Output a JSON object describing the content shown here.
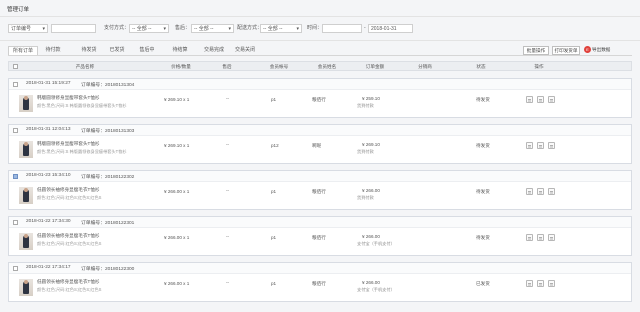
{
  "page": {
    "title": "管理订单"
  },
  "filters": {
    "order_field": "订单编号",
    "order_input": "",
    "pay_label": "支付方式：",
    "pay_select": "-- 全部 --",
    "status_label": "售后：",
    "status_select": "-- 全部 --",
    "ship_label": "配送方式：",
    "ship_select": "-- 全部 --",
    "time_label": "时间：",
    "date_from": "",
    "date_sep": "-",
    "date_to": "2018-01-31"
  },
  "tabs": [
    {
      "label": "所有订单",
      "active": true
    },
    {
      "label": "待付款"
    },
    {
      "label": "待发货"
    },
    {
      "label": "已发货"
    },
    {
      "label": "售后中"
    },
    {
      "label": "待结算"
    },
    {
      "label": "交易完成"
    },
    {
      "label": "交易关闭"
    }
  ],
  "actions": {
    "batch": "批量操作",
    "print": "打印发货单",
    "export": "导出数据",
    "export_icon": "E"
  },
  "table_headers": [
    "产品名称",
    "价格/数量",
    "售后",
    "会员帐号",
    "会员姓名",
    "订单金额",
    "分销商",
    "状态",
    "操作"
  ],
  "orders": [
    {
      "date": "2018-01-31 15:19:27",
      "order_no": "订单编号：20180131304",
      "product": "韩版圆领修身显瘦带套头T恤衫",
      "spec": "颜色:黑色;尺码:S  韩版圆领修身显瘦带套头T恤衫",
      "price_qty": "¥ 269.10 x 1",
      "after_sale": "--",
      "account": "p1",
      "member": "粮佰行",
      "amount": "¥ 259.10",
      "amount_note": "货到付款",
      "distributor": "",
      "status": "待发货",
      "checked": false
    },
    {
      "date": "2018-01-31 12:04:13",
      "order_no": "订单编号：20180131303",
      "product": "韩版圆领修身显瘦带套头T恤衫",
      "spec": "颜色:黑色;尺码:S  韩版圆领修身显瘦带套头T恤衫",
      "price_qty": "¥ 269.10 x 1",
      "after_sale": "--",
      "account": "p12",
      "member": "啊呢",
      "amount": "¥ 269.10",
      "amount_note": "货到付款",
      "distributor": "",
      "status": "待发货",
      "checked": false
    },
    {
      "date": "2018-01-23 15:34:10",
      "order_no": "订单编号：20180122302",
      "product": "低圆领长袖修身显瘦毛衣T恤衫",
      "spec": "颜色:红色;尺码:红色S;红色S;红色S",
      "price_qty": "¥ 266.00 x 1",
      "after_sale": "--",
      "account": "p1",
      "member": "粮佰行",
      "amount": "¥ 266.00",
      "amount_note": "货到付款",
      "distributor": "",
      "status": "待发货",
      "checked": true
    },
    {
      "date": "2018-01-22 17:34:30",
      "order_no": "订单编号：20180122301",
      "product": "低圆领长袖修身显瘦毛衣T恤衫",
      "spec": "颜色:红色;尺码:红色S;红色S;红色S",
      "price_qty": "¥ 266.00 x 1",
      "after_sale": "--",
      "account": "p1",
      "member": "粮佰行",
      "amount": "¥ 266.00",
      "amount_note": "支付宝（手机支付）",
      "distributor": "",
      "status": "待发货",
      "checked": false
    },
    {
      "date": "2018-01-22 17:34:17",
      "order_no": "订单编号：20180122300",
      "product": "低圆领长袖修身显瘦毛衣T恤衫",
      "spec": "颜色:红色;尺码:红色S;红色S;红色S",
      "price_qty": "¥ 266.00 x 1",
      "after_sale": "--",
      "account": "p1",
      "member": "粮佰行",
      "amount": "¥ 266.00",
      "amount_note": "支付宝（手机支付）",
      "distributor": "",
      "status": "已发货",
      "checked": false
    }
  ]
}
